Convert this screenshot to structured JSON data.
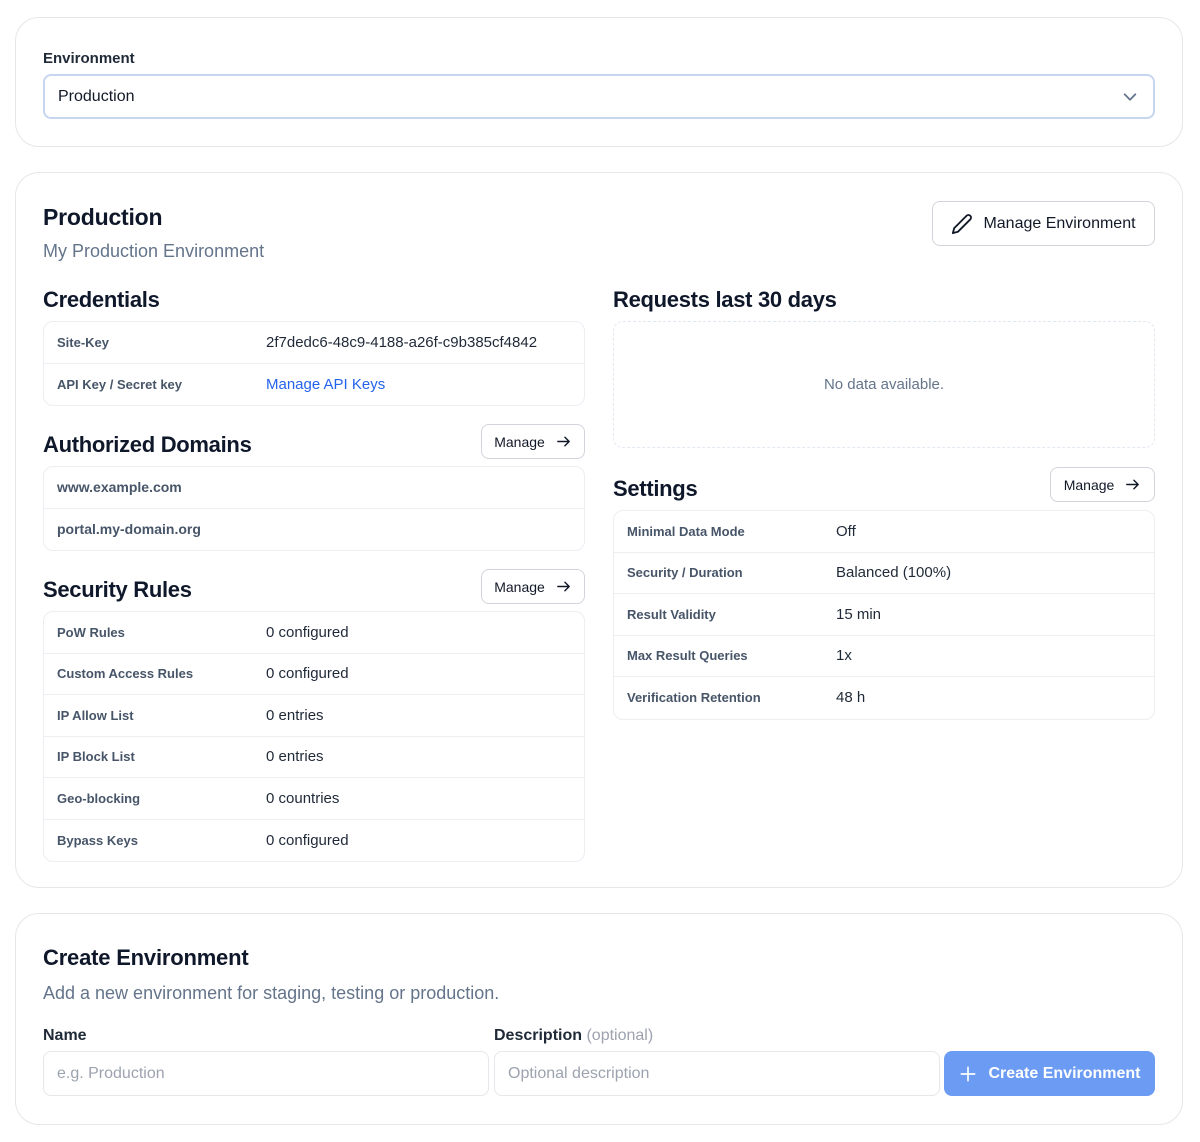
{
  "environment_selector": {
    "label": "Environment",
    "selected": "Production"
  },
  "environment": {
    "title": "Production",
    "subtitle": "My Production Environment",
    "manage_label": "Manage Environment"
  },
  "credentials": {
    "title": "Credentials",
    "rows": [
      {
        "key": "Site-Key",
        "value": "2f7dedc6-48c9-4188-a26f-c9b385cf4842"
      },
      {
        "key": "API Key / Secret key",
        "value": "Manage API Keys"
      }
    ]
  },
  "domains": {
    "title": "Authorized Domains",
    "manage_label": "Manage",
    "items": [
      "www.example.com",
      "portal.my-domain.org"
    ]
  },
  "security_rules": {
    "title": "Security Rules",
    "manage_label": "Manage",
    "rows": [
      {
        "key": "PoW Rules",
        "value": "0 configured"
      },
      {
        "key": "Custom Access Rules",
        "value": "0 configured"
      },
      {
        "key": "IP Allow List",
        "value": "0 entries"
      },
      {
        "key": "IP Block List",
        "value": "0 entries"
      },
      {
        "key": "Geo-blocking",
        "value": "0 countries"
      },
      {
        "key": "Bypass Keys",
        "value": "0 configured"
      }
    ]
  },
  "requests": {
    "title": "Requests last 30 days",
    "empty_text": "No data available."
  },
  "settings": {
    "title": "Settings",
    "manage_label": "Manage",
    "rows": [
      {
        "key": "Minimal Data Mode",
        "value": "Off"
      },
      {
        "key": "Security / Duration",
        "value": "Balanced (100%)"
      },
      {
        "key": "Result Validity",
        "value": "15 min"
      },
      {
        "key": "Max Result Queries",
        "value": "1x"
      },
      {
        "key": "Verification Retention",
        "value": "48 h"
      }
    ]
  },
  "create": {
    "title": "Create Environment",
    "subtitle": "Add a new environment for staging, testing or production.",
    "name_label": "Name",
    "name_placeholder": "e.g. Production",
    "desc_label": "Description",
    "desc_optional": "(optional)",
    "desc_placeholder": "Optional description",
    "button_label": "Create Environment"
  },
  "colors": {
    "primary": "#6b9bf2",
    "link": "#2563eb",
    "border": "#e5e7eb"
  }
}
